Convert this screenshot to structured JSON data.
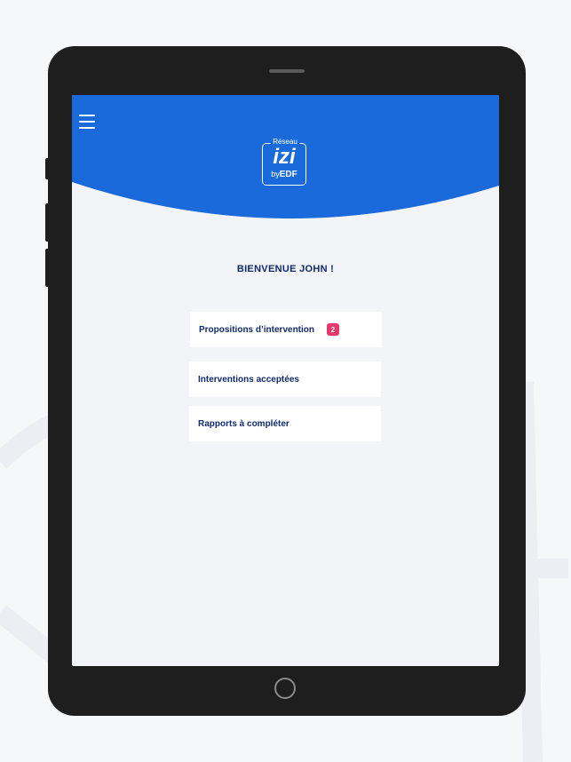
{
  "app": {
    "logo": {
      "top": "Réseau",
      "main": "izi",
      "by": "by",
      "brand": "EDF"
    },
    "welcome": "BIENVENUE JOHN !",
    "menu": [
      {
        "label": "Propositions d’intervention",
        "badge": "2"
      },
      {
        "label": "Interventions acceptées"
      },
      {
        "label": "Rapports à compléter"
      }
    ]
  },
  "colors": {
    "header": "#1a6adb",
    "text": "#0f2a6b",
    "badge": "#e8376a",
    "background": "#f3f4f8",
    "device": "#1e1e1e"
  },
  "icons": [
    "menu-icon"
  ]
}
